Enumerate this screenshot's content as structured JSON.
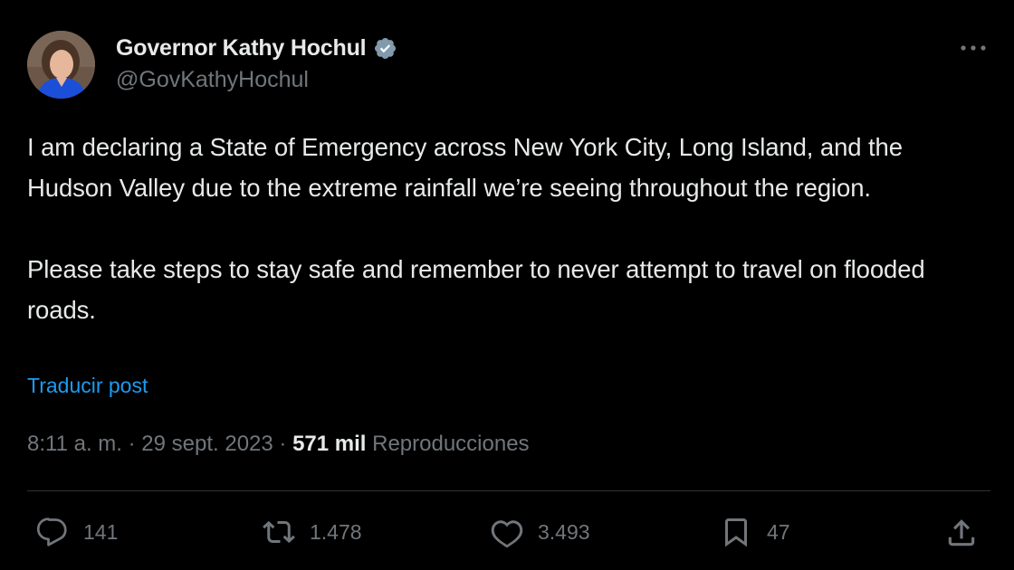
{
  "author": {
    "display_name": "Governor Kathy Hochul",
    "handle": "@GovKathyHochul",
    "verified_icon": "verified-badge-icon"
  },
  "tweet": {
    "paragraph1": "I am declaring a State of Emergency across New York City, Long Island, and the Hudson Valley due to the extreme rainfall we’re seeing throughout the region.",
    "paragraph2": "Please take steps to stay safe and remember to never attempt to travel on flooded roads.",
    "translate_label": "Traducir post"
  },
  "meta": {
    "time": "8:11 a. m.",
    "sep1": " · ",
    "date": "29 sept. 2023",
    "sep2": " · ",
    "views_count": "571 mil",
    "views_label": " Reproducciones"
  },
  "actions": {
    "replies": "141",
    "reposts": "1.478",
    "likes": "3.493",
    "bookmarks": "47"
  },
  "colors": {
    "background": "#000000",
    "text": "#e7e9ea",
    "muted": "#71767b",
    "link": "#1d9bf0",
    "verified_badge": "#829aab"
  }
}
